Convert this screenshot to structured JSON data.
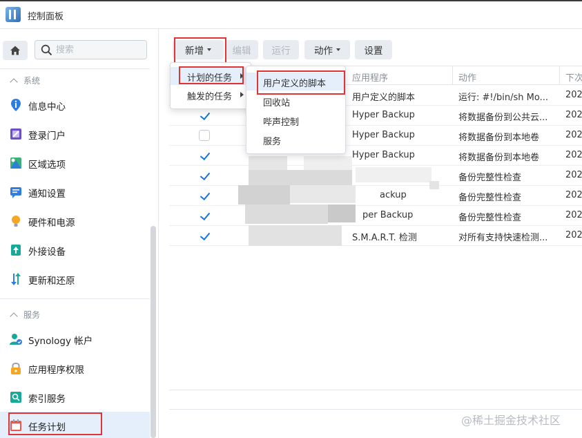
{
  "window": {
    "title": "控制面板"
  },
  "sidebar": {
    "search_placeholder": "搜索",
    "sections": [
      {
        "label": "系统"
      },
      {
        "label": "服务"
      }
    ],
    "system_items": [
      {
        "label": "信息中心",
        "icon": "info-icon"
      },
      {
        "label": "登录门户",
        "icon": "login-portal-icon"
      },
      {
        "label": "区域选项",
        "icon": "region-icon"
      },
      {
        "label": "通知设置",
        "icon": "notification-icon"
      },
      {
        "label": "硬件和电源",
        "icon": "bulb-icon"
      },
      {
        "label": "外接设备",
        "icon": "external-device-icon"
      },
      {
        "label": "更新和还原",
        "icon": "update-restore-icon"
      }
    ],
    "service_items": [
      {
        "label": "Synology 帐户",
        "icon": "account-icon"
      },
      {
        "label": "应用程序权限",
        "icon": "lock-icon"
      },
      {
        "label": "索引服务",
        "icon": "index-search-icon"
      },
      {
        "label": "任务计划",
        "icon": "calendar-icon",
        "active": true
      }
    ]
  },
  "toolbar": {
    "add": "新增",
    "edit": "编辑",
    "run": "运行",
    "action": "动作",
    "settings": "设置"
  },
  "table": {
    "headers": [
      "应用程序",
      "动作",
      "下次"
    ],
    "rows": [
      {
        "checked": true,
        "app": "用户定义的脚本",
        "action": "运行: #!/bin/sh Mo...",
        "next": "202"
      },
      {
        "checked": true,
        "app": "Hyper Backup",
        "action": "将数据备份到公共云...",
        "next": "202"
      },
      {
        "checked": false,
        "app": "Hyper Backup",
        "action": "将数据备份到本地卷",
        "next": "202"
      },
      {
        "checked": true,
        "app": "Hyper Backup",
        "action": "将数据备份到本地卷",
        "next": "202"
      },
      {
        "checked": true,
        "app": "",
        "action": "备份完整性检查",
        "next": "202"
      },
      {
        "checked": true,
        "app": "ackup",
        "action": "备份完整性检查",
        "next": "202"
      },
      {
        "checked": true,
        "app": "per Backup",
        "action": "备份完整性检查",
        "next": "202"
      },
      {
        "checked": true,
        "app": "S.M.A.R.T. 检测",
        "action": "对所有支持快速检测...",
        "next": "202"
      }
    ]
  },
  "add_menu": {
    "items": [
      {
        "label": "计划的任务"
      },
      {
        "label": "触发的任务"
      }
    ]
  },
  "submenu": {
    "items": [
      {
        "label": "用户定义的脚本"
      },
      {
        "label": "回收站"
      },
      {
        "label": "哔声控制"
      },
      {
        "label": "服务"
      }
    ]
  },
  "watermark": "@稀土掘金技术社区",
  "colors": {
    "accent": "#1a73d9",
    "highlight": "#e5effb",
    "annotation": "#e03333"
  }
}
